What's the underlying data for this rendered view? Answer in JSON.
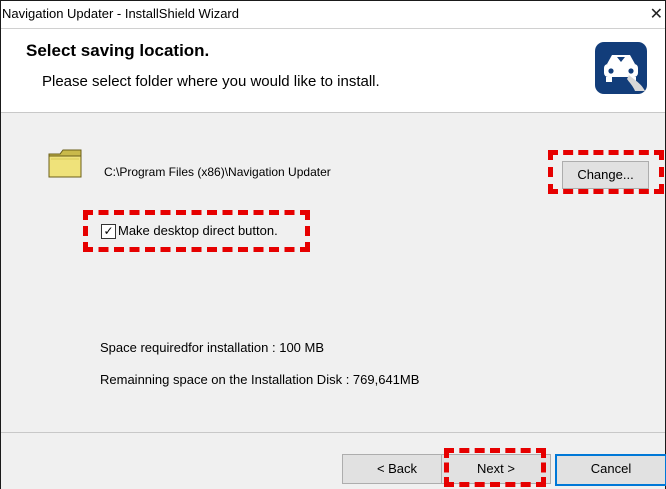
{
  "window": {
    "title": "Navigation Updater - InstallShield Wizard",
    "close_glyph": "✕"
  },
  "header": {
    "title": "Select saving location.",
    "subtitle": "Please select folder where you would like to install.",
    "icon": "car-app-icon"
  },
  "content": {
    "folder_icon": "folder-icon",
    "install_path": "C:\\Program Files (x86)\\Navigation Updater",
    "change_label": "Change...",
    "checkbox": {
      "checked": true,
      "mark": "✓",
      "label": "Make desktop direct button."
    },
    "space_required": "Space requiredfor installation : 100 MB",
    "space_remaining": "Remainning space on the Installation Disk :   769,641MB"
  },
  "footer": {
    "back_label": "< Back",
    "next_label": "Next >",
    "cancel_label": "Cancel"
  },
  "colors": {
    "highlight": "#e60000",
    "accent": "#0078d7",
    "icon_bg": "#123d7a"
  }
}
